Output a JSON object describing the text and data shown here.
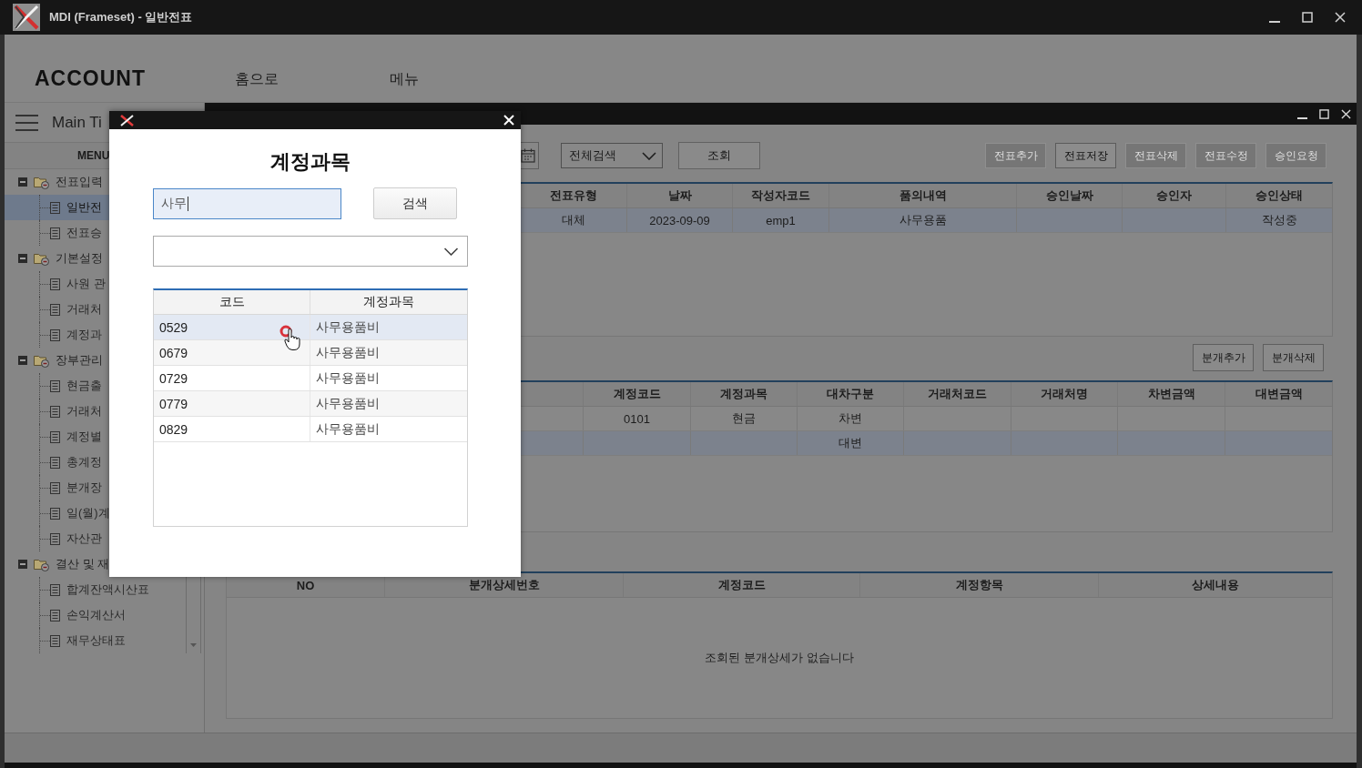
{
  "window": {
    "title": "MDI (Frameset) - 일반전표"
  },
  "header": {
    "brand": "ACCOUNT",
    "nav": [
      "홈으로",
      "메뉴"
    ]
  },
  "sidebar": {
    "title": "Main Ti",
    "menu_label": "MENU",
    "tree": [
      {
        "label": "전표입력",
        "expanded": true,
        "children": [
          {
            "label": "일반전",
            "selected": true
          },
          {
            "label": "전표승",
            "selected": false
          }
        ]
      },
      {
        "label": "기본설정",
        "expanded": true,
        "children": [
          {
            "label": "사원 관",
            "selected": false
          },
          {
            "label": "거래처",
            "selected": false
          },
          {
            "label": "계정과",
            "selected": false
          }
        ]
      },
      {
        "label": "장부관리",
        "expanded": true,
        "children": [
          {
            "label": "현금출",
            "selected": false
          },
          {
            "label": "거래처",
            "selected": false
          },
          {
            "label": "계정별",
            "selected": false
          },
          {
            "label": "총계정",
            "selected": false
          },
          {
            "label": "분개장",
            "selected": false
          },
          {
            "label": "일(월)계",
            "selected": false
          },
          {
            "label": "자산관",
            "selected": false
          }
        ]
      },
      {
        "label": "결산 및 재",
        "expanded": true,
        "children": [
          {
            "label": "합계잔액시산표",
            "selected": false
          },
          {
            "label": "손익계산서",
            "selected": false
          },
          {
            "label": "재무상태표",
            "selected": false
          }
        ]
      }
    ]
  },
  "voucher_window": {
    "toolbar": {
      "scope_select": "전체검색",
      "query_button": "조회",
      "actions": [
        {
          "label": "전표추가",
          "disabled": true
        },
        {
          "label": "전표저장",
          "disabled": false
        },
        {
          "label": "전표삭제",
          "disabled": true
        },
        {
          "label": "전표수정",
          "disabled": true
        },
        {
          "label": "승인요청",
          "disabled": true
        }
      ]
    },
    "voucher_table": {
      "columns": [
        "전표유형",
        "날짜",
        "작성자코드",
        "품의내역",
        "승인날짜",
        "승인자",
        "승인상태"
      ],
      "rows": [
        {
          "voucher_type": "대체",
          "date": "2023-09-09",
          "author_code": "emp1",
          "description": "사무용품",
          "status": "작성중",
          "selected": true
        }
      ]
    },
    "entry_actions": [
      "분개추가",
      "분개삭제"
    ],
    "entry_table": {
      "columns": [
        "계정코드",
        "계정과목",
        "대차구분",
        "거래처코드",
        "거래처명",
        "차변금액",
        "대변금액"
      ],
      "rows": [
        {
          "account_code": "0101",
          "account_name": "현금",
          "dc_side": "차변",
          "selected": false
        },
        {
          "dc_side": "대변",
          "selected": true
        }
      ]
    },
    "detail_table": {
      "columns": [
        "NO",
        "분개상세번호",
        "계정코드",
        "계정항목",
        "상세내용"
      ],
      "empty_message": "조회된 분개상세가 없습니다"
    }
  },
  "dialog": {
    "title": "계정과목",
    "search_field": {
      "value": "사무"
    },
    "search_button": "검색",
    "table": {
      "columns": [
        "코드",
        "계정과목"
      ],
      "rows": [
        {
          "code": "0529",
          "account_name": "사무용품비",
          "selected": true
        },
        {
          "code": "0679",
          "account_name": "사무용품비",
          "selected": false
        },
        {
          "code": "0729",
          "account_name": "사무용품비",
          "selected": false
        },
        {
          "code": "0779",
          "account_name": "사무용품비",
          "selected": false
        },
        {
          "code": "0829",
          "account_name": "사무용품비",
          "selected": false
        }
      ]
    }
  }
}
